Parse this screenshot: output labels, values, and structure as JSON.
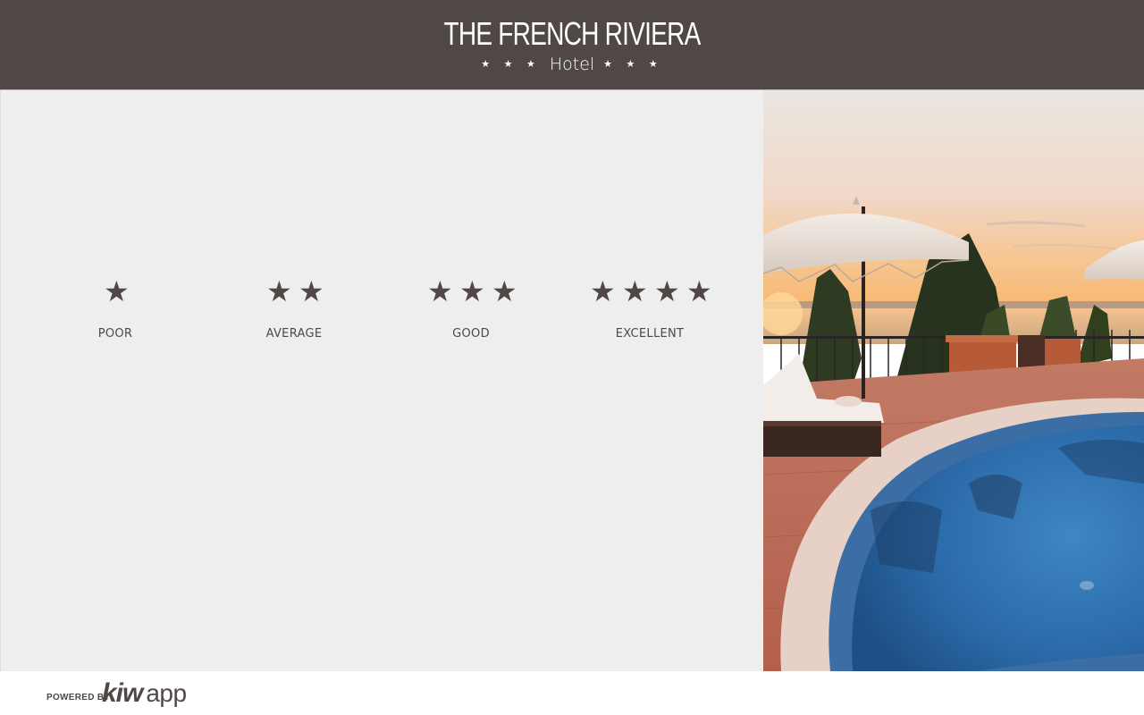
{
  "header": {
    "title": "THE FRENCH RIVIERA",
    "subtitle": "Hotel",
    "decoration_left": "★ ★ ★",
    "decoration_right": "★ ★ ★"
  },
  "rating": {
    "options": [
      {
        "stars": "★",
        "label": "POOR",
        "value": 1
      },
      {
        "stars": "★★",
        "label": "AVERAGE",
        "value": 2
      },
      {
        "stars": "★★★",
        "label": "GOOD",
        "value": 3
      },
      {
        "stars": "★★★★",
        "label": "EXCELLENT",
        "value": 4
      }
    ]
  },
  "footer": {
    "powered_by": "POWERED BY",
    "logo_kiw": "kiw",
    "logo_app": "app"
  },
  "colors": {
    "brand": "#4f4846",
    "panel_background": "#eeeeee",
    "text_on_brand": "#ffffff"
  }
}
